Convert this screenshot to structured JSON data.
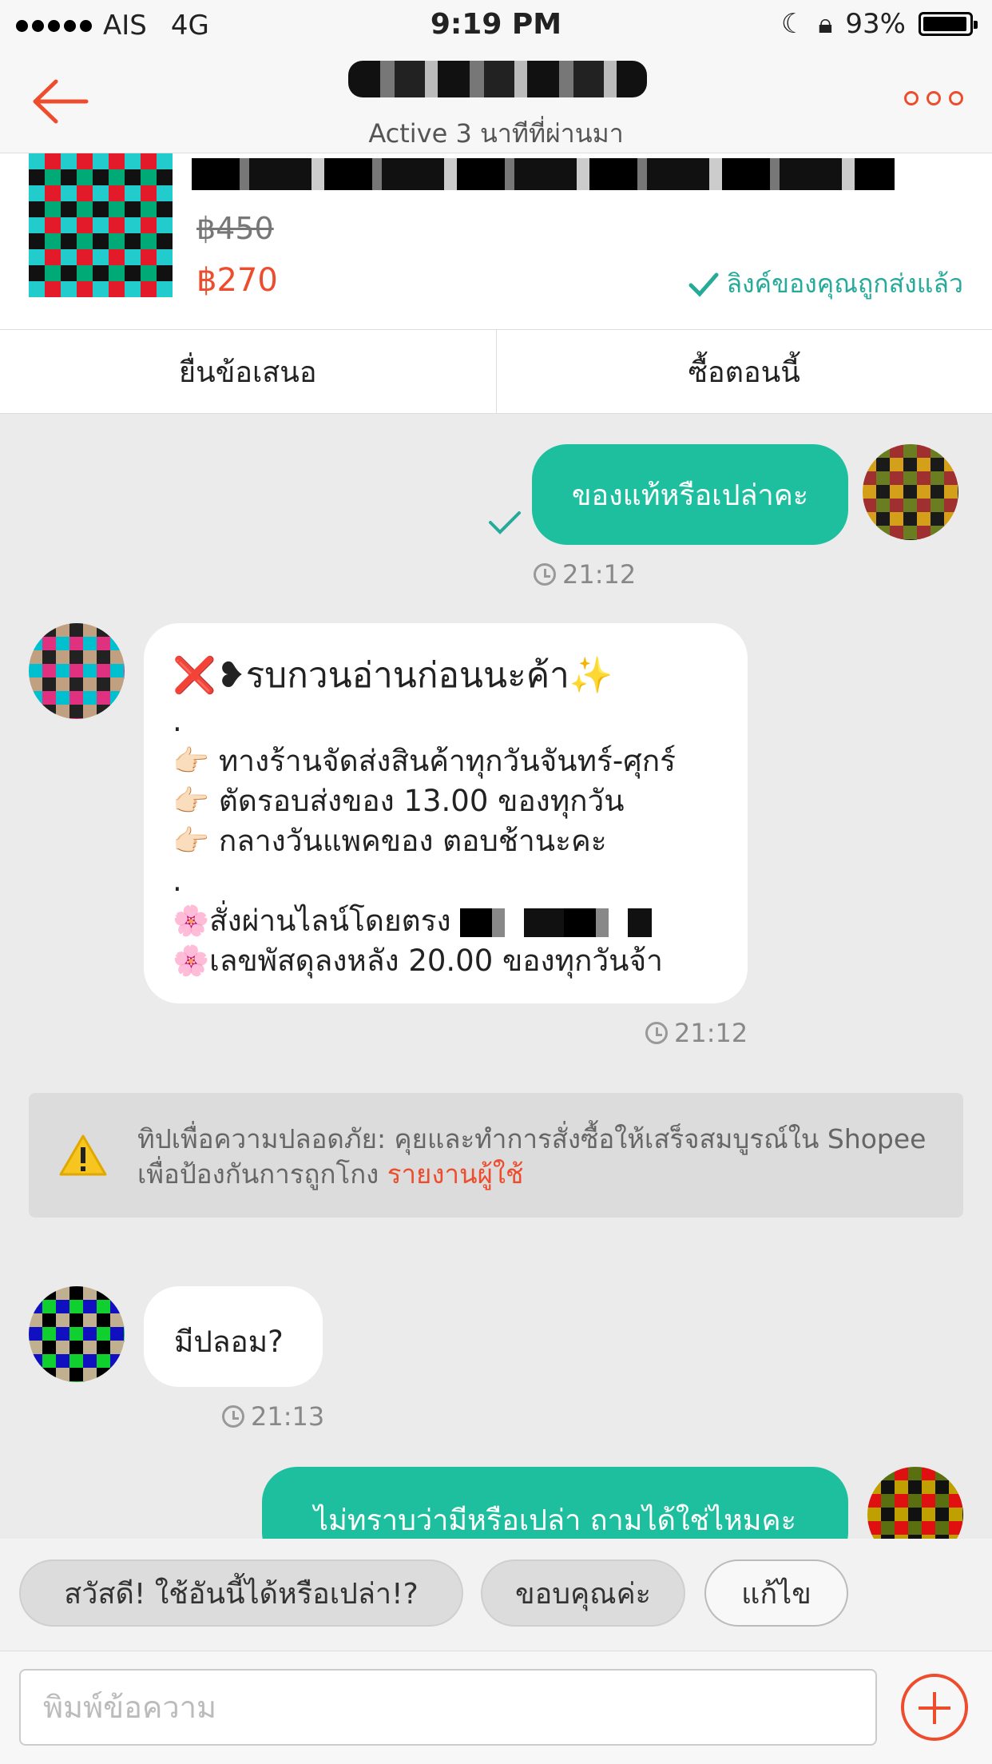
{
  "status_bar": {
    "carrier": "AIS",
    "network": "4G",
    "time": "9:19 PM",
    "battery": "93%"
  },
  "header": {
    "subtitle": "Active 3 นาทีที่ผ่านมา"
  },
  "product": {
    "old_price": "฿450",
    "new_price": "฿270",
    "sent_label": "ลิงค์ของคุณถูกส่งแล้ว"
  },
  "actions": {
    "offer": "ยื่นข้อเสนอ",
    "buy_now": "ซื้อตอนนี้"
  },
  "messages": [
    {
      "side": "out",
      "text": "ของแท้หรือเปล่าคะ",
      "time": "21:12"
    },
    {
      "side": "in",
      "lines": [
        "❌❥รบกวนอ่านก่อนนะค้า✨",
        ".",
        "👉🏻 ทางร้านจัดส่งสินค้าทุกวันจันทร์-ศุกร์",
        "👉🏻 ตัดรอบส่งของ 13.00 ของทุกวัน",
        "👉🏻 กลางวันแพคของ ตอบช้านะคะ",
        ".",
        "🌸สั่งผ่านไลน์โดยตรง",
        "🌸เลขพัสดุลงหลัง 20.00 ของทุกวันจ้า"
      ],
      "time": "21:12"
    },
    {
      "side": "in",
      "text": "มีปลอม?",
      "time": "21:13"
    },
    {
      "side": "out",
      "text": "ไม่ทราบว่ามีหรือเปล่า ถามได้ใช่ไหมคะ"
    }
  ],
  "warning": {
    "text": "ทิปเพื่อความปลอดภัย: คุยและทำการสั่งซื้อให้เสร็จสมบูรณ์ใน Shopee เพื่อป้องกันการถูกโกง",
    "link": "รายงานผู้ใช้"
  },
  "quick_replies": [
    "สวัสดี! ใช้อันนี้ได้หรือเปล่า!?",
    "ขอบคุณค่ะ",
    "แก้ไข"
  ],
  "input": {
    "placeholder": "พิมพ์ข้อความ"
  },
  "colors": {
    "accent": "#ee4d2d",
    "bubble_out": "#1dbf9e",
    "sent_check": "#26aa99"
  }
}
